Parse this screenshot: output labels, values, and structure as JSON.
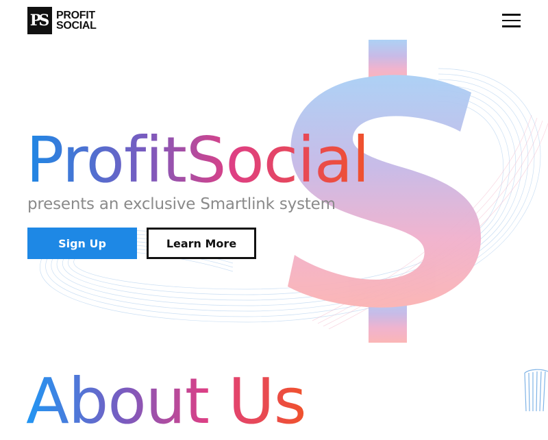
{
  "header": {
    "logo": {
      "mark": "PS",
      "line1": "PROFIT",
      "line2": "SOCIAL"
    },
    "menu_icon": "hamburger-menu-icon"
  },
  "hero": {
    "title": "ProfitSocial",
    "subtitle": "presents an exclusive Smartlink system",
    "signup_label": "Sign Up",
    "learn_more_label": "Learn More",
    "background_icon": "dollar-sign-icon"
  },
  "about": {
    "title": "About Us"
  },
  "colors": {
    "accent_blue": "#1e88e5",
    "gradient": [
      "#1e88e5",
      "#7a5bbf",
      "#de3f84",
      "#f0522b"
    ],
    "subtitle_gray": "#8a8a8a",
    "dark": "#111111"
  }
}
